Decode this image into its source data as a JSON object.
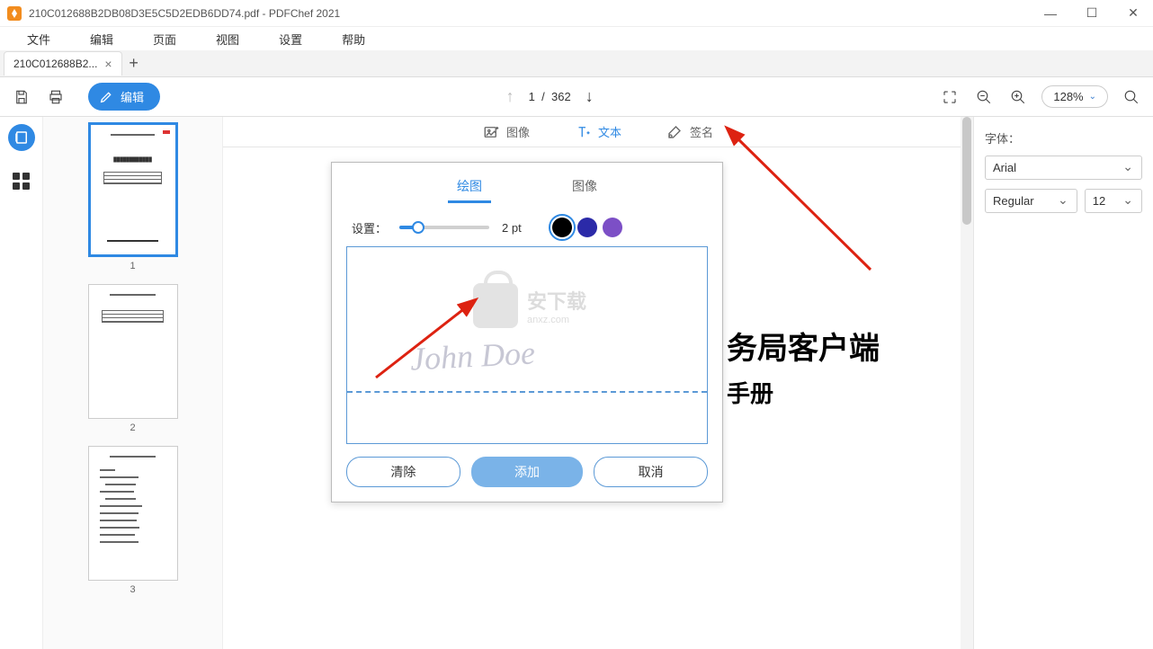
{
  "titlebar": {
    "title": "210C012688B2DB08D3E5C5D2EDB6DD74.pdf - PDFChef 2021"
  },
  "menu": {
    "file": "文件",
    "edit": "编辑",
    "page": "页面",
    "view": "视图",
    "settings": "设置",
    "help": "帮助"
  },
  "tab": {
    "label": "210C012688B2..."
  },
  "toolbar": {
    "edit_label": "编辑",
    "page_current": "1",
    "page_sep": "/",
    "page_total": "362",
    "zoom": "128%"
  },
  "editbar": {
    "image": "图像",
    "text": "文本",
    "signature": "签名"
  },
  "document": {
    "line1": "务局客户端",
    "line2": "手册"
  },
  "signature_panel": {
    "tab_draw": "绘图",
    "tab_image": "图像",
    "settings_label": "设置：",
    "pt_value": "2 pt",
    "btn_clear": "清除",
    "btn_add": "添加",
    "btn_cancel": "取消",
    "sample": "John Doe",
    "colors": [
      "#000000",
      "#2b2aa8",
      "#7c4fc6"
    ]
  },
  "watermark": {
    "line1": "安下载",
    "line2": "anxz.com"
  },
  "rightbar": {
    "font_label": "字体：",
    "font_value": "Arial",
    "weight_value": "Regular",
    "size_value": "12"
  },
  "thumbs": {
    "n1": "1",
    "n2": "2",
    "n3": "3"
  }
}
